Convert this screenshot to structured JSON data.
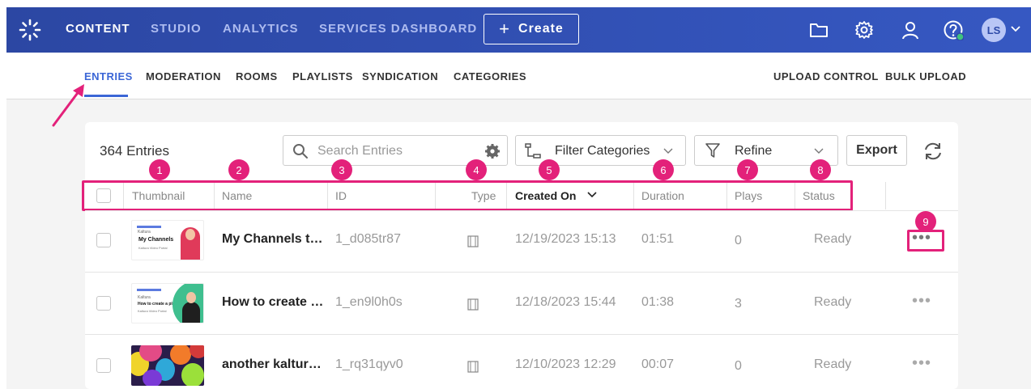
{
  "topnav": {
    "items": [
      {
        "label": "CONTENT"
      },
      {
        "label": "STUDIO"
      },
      {
        "label": "ANALYTICS"
      },
      {
        "label": "SERVICES DASHBOARD"
      }
    ],
    "create_label": "Create",
    "avatar_initials": "LS",
    "icons": [
      "folder-icon",
      "gear-icon",
      "user-icon",
      "help-icon",
      "chevron-down-icon"
    ],
    "colors": {
      "bar": "#2e4aa8",
      "accent": "#3b66d6",
      "highlight": "#e3217a",
      "online": "#3fc27f"
    }
  },
  "subnav": {
    "items": [
      {
        "label": "ENTRIES"
      },
      {
        "label": "MODERATION"
      },
      {
        "label": "ROOMS"
      },
      {
        "label": "PLAYLISTS"
      },
      {
        "label": "SYNDICATION"
      },
      {
        "label": "CATEGORIES"
      }
    ],
    "right_items": [
      {
        "label": "UPLOAD CONTROL"
      },
      {
        "label": "BULK UPLOAD"
      }
    ]
  },
  "toolbar": {
    "entries_count": "364 Entries",
    "search_placeholder": "Search Entries",
    "filter_categories": "Filter Categories",
    "refine": "Refine",
    "export": "Export"
  },
  "badges": [
    "1",
    "2",
    "3",
    "4",
    "5",
    "6",
    "7",
    "8",
    "9"
  ],
  "table": {
    "columns": [
      "Thumbnail",
      "Name",
      "ID",
      "Type",
      "Created On",
      "Duration",
      "Plays",
      "Status"
    ],
    "sort_column": "Created On",
    "rows": [
      {
        "name": "My Channels t…",
        "id": "1_d085tr87",
        "created": "12/19/2023 15:13",
        "duration": "01:51",
        "plays": "0",
        "status": "Ready",
        "thumb_title": "My Channels",
        "thumb_sub": "Kaltura Video Portal",
        "thumb_brand": "Kaltura"
      },
      {
        "name": "How to create …",
        "id": "1_en9l0h0s",
        "created": "12/18/2023 15:44",
        "duration": "01:38",
        "plays": "3",
        "status": "Ready",
        "thumb_title": "How to create a playlist",
        "thumb_sub": "Kaltura Video Portal",
        "thumb_brand": "Kaltura"
      },
      {
        "name": "another kaltur…",
        "id": "1_rq31qyv0",
        "created": "12/10/2023 12:29",
        "duration": "00:07",
        "plays": "0",
        "status": "Ready",
        "thumb_title": "",
        "thumb_sub": "",
        "thumb_brand": ""
      }
    ],
    "row_action": "•••"
  }
}
